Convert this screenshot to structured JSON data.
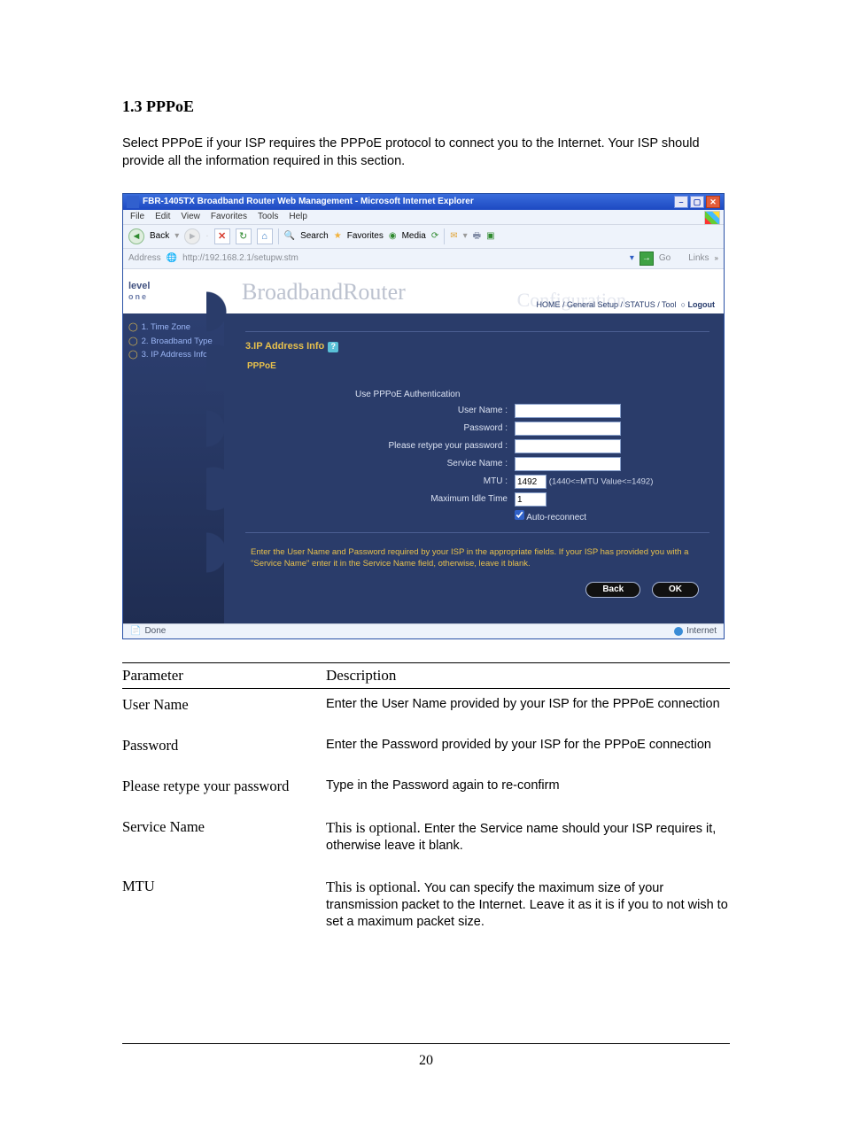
{
  "section": {
    "title": "1.3 PPPoE"
  },
  "intro": "Select PPPoE if your ISP requires the PPPoE protocol to connect you to the Internet. Your ISP should provide all the information required in this section.",
  "browser": {
    "title": "FBR-1405TX Broadband Router Web Management - Microsoft Internet Explorer",
    "menus": [
      "File",
      "Edit",
      "View",
      "Favorites",
      "Tools",
      "Help"
    ],
    "toolbar": {
      "back": "Back",
      "search": "Search",
      "favorites": "Favorites",
      "media": "Media"
    },
    "address_label": "Address",
    "url": "http://192.168.2.1/setupw.stm",
    "go": "Go",
    "links": "Links",
    "status_left": "Done",
    "status_right": "Internet"
  },
  "router": {
    "brand_big": "BroadbandRouter",
    "brand_sub": "Configuration",
    "logo_l1": "level",
    "logo_l2": "one",
    "crumbs": {
      "home": "HOME",
      "gs": "General Setup",
      "status": "STATUS",
      "tool": "Tool",
      "logout": "Logout"
    },
    "nav": [
      "1. Time Zone",
      "2. Broadband Type",
      "3. IP Address Info"
    ],
    "heading": "3.IP Address Info",
    "subheading": "PPPoE",
    "form": {
      "group_label": "Use PPPoE Authentication",
      "user": "User Name :",
      "pass": "Password :",
      "retype": "Please retype your password :",
      "service": "Service Name :",
      "mtu": "MTU :",
      "mtu_value": "1492",
      "mtu_note": "(1440<=MTU Value<=1492)",
      "idle": "Maximum Idle Time",
      "idle_value": "1",
      "auto": "Auto-reconnect"
    },
    "helptext": "Enter the User Name and Password required by your ISP in the appropriate fields. If your ISP has provided you with a \"Service Name\" enter it in the Service Name field, otherwise, leave it blank.",
    "buttons": {
      "back": "Back",
      "ok": "OK"
    }
  },
  "table": {
    "headers": {
      "param": "Parameter",
      "desc": "Description"
    },
    "rows": [
      {
        "param": "User Name",
        "lead": "",
        "desc": "Enter the User Name provided by your ISP for the PPPoE connection"
      },
      {
        "param": "Password",
        "lead": "",
        "desc": "Enter the Password provided by your ISP for the PPPoE connection"
      },
      {
        "param": "Please retype your password",
        "lead": "",
        "desc": "Type in the Password again to re-confirm"
      },
      {
        "param": "Service Name",
        "lead": "This is optional. ",
        "desc": "Enter the Service name should your ISP requires it, otherwise leave it blank."
      },
      {
        "param": "MTU",
        "lead": "This is optional. ",
        "desc": "You can specify the maximum size of your transmission packet to the Internet. Leave it as it is if you to not wish to set a maximum packet size."
      }
    ]
  },
  "page_number": "20"
}
